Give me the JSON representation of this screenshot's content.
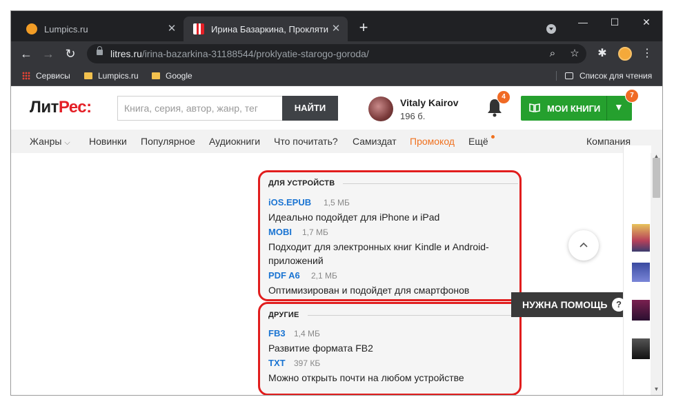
{
  "browser": {
    "tabs": [
      {
        "title": "Lumpics.ru",
        "active": false,
        "icon": "orange-circle-favicon"
      },
      {
        "title": "Ирина Базаркина, Проклятие С",
        "active": true,
        "icon": "litres-favicon"
      }
    ],
    "url_host": "litres.ru",
    "url_path": "/irina-bazarkina-31188544/proklyatie-starogo-goroda/",
    "bookmarks": [
      {
        "label": "Сервисы",
        "icon": "apps-grid-icon"
      },
      {
        "label": "Lumpics.ru",
        "icon": "folder-icon"
      },
      {
        "label": "Google",
        "icon": "folder-icon"
      }
    ],
    "reading_list": "Список для чтения"
  },
  "header": {
    "logo_left": "Лит",
    "logo_right": "Рес:",
    "search_placeholder": "Книга, серия, автор, жанр, тег",
    "search_button": "НАЙТИ",
    "user_name": "Vitaly Kairov",
    "user_points": "196 б.",
    "notifications_count": "4",
    "my_books_label": "МОИ КНИГИ",
    "my_books_count": "7"
  },
  "menu": {
    "items": [
      "Жанры",
      "Новинки",
      "Популярное",
      "Аудиокниги",
      "Что почитать?",
      "Самиздат",
      "Промокод",
      "Ещё",
      "Компания"
    ]
  },
  "devices": {
    "title": "ДЛЯ УСТРОЙСТВ",
    "formats": [
      {
        "name": "iOS.EPUB",
        "size": "1,5 МБ",
        "desc": "Идеально подойдет для iPhone и iPad"
      },
      {
        "name": "MOBI",
        "size": "1,7 МБ",
        "desc": "Подходит для электронных книг Kindle и Android-приложений"
      },
      {
        "name": "PDF A6",
        "size": "2,1 МБ",
        "desc": "Оптимизирован и подойдет для смартфонов"
      }
    ]
  },
  "others": {
    "title": "ДРУГИЕ",
    "formats": [
      {
        "name": "FB3",
        "size": "1,4 МБ",
        "desc": "Развитие формата FB2"
      },
      {
        "name": "TXT",
        "size": "397 КБ",
        "desc": "Можно открыть почти на любом устройстве"
      }
    ]
  },
  "help": {
    "label": "НУЖНА ПОМОЩЬ",
    "icon": "?"
  },
  "colors": {
    "brand_red": "#e41f26",
    "accent_green": "#25a02e",
    "link_blue": "#1a74d2",
    "promo_orange": "#f0711f",
    "highlight": "#e11d1d"
  }
}
